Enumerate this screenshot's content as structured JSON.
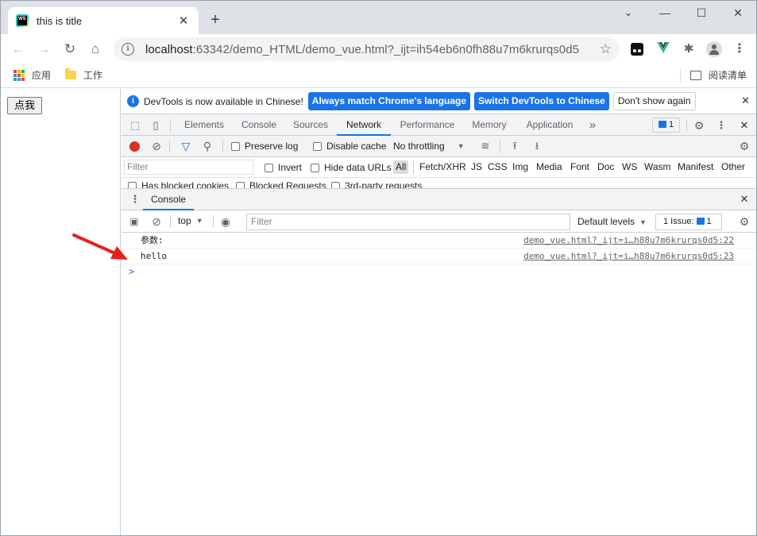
{
  "browser": {
    "tab_title": "this is title",
    "tab_close": "✕",
    "new_tab": "+",
    "window_controls": {
      "minimize": "⌄",
      "min": "—",
      "max": "☐",
      "close": "✕"
    },
    "url_host": "localhost",
    "url_rest": ":63342/demo_HTML/demo_vue.html?_ijt=ih54eb6n0fh88u7m6krurqs0d5",
    "bookmarks": [
      {
        "label": "应用",
        "icon": "apps-grid-icon"
      },
      {
        "label": "工作",
        "icon": "folder-icon"
      }
    ],
    "reading_list": "阅读清单"
  },
  "page": {
    "button_label": "点我"
  },
  "devtools": {
    "infobar": {
      "message": "DevTools is now available in Chinese!",
      "match_language": "Always match Chrome's language",
      "switch_chinese": "Switch DevTools to Chinese",
      "dont_show": "Don't show again"
    },
    "tabs": [
      "Elements",
      "Console",
      "Sources",
      "Network",
      "Performance",
      "Memory",
      "Application"
    ],
    "active_tab": "Network",
    "more_tabs": "»",
    "issues_count": "1",
    "network": {
      "preserve_log": "Preserve log",
      "disable_cache": "Disable cache",
      "throttling": "No throttling",
      "filter_placeholder": "Filter",
      "invert": "Invert",
      "hide_data_urls": "Hide data URLs",
      "types": [
        "All",
        "Fetch/XHR",
        "JS",
        "CSS",
        "Img",
        "Media",
        "Font",
        "Doc",
        "WS",
        "Wasm",
        "Manifest",
        "Other"
      ],
      "has_blocked_cookies": "Has blocked cookies",
      "blocked_requests": "Blocked Requests",
      "third_party": "3rd-party requests"
    },
    "drawer": {
      "tab": "Console",
      "context": "top",
      "filter_placeholder": "Filter",
      "levels": "Default levels",
      "issue_label": "1 Issue:",
      "issue_count": "1",
      "logs": [
        {
          "message": "参数:",
          "source": "demo_vue.html?_ijt=i…h88u7m6krurqs0d5:22"
        },
        {
          "message": "hello",
          "source": "demo_vue.html?_ijt=i…h88u7m6krurqs0d5:23"
        }
      ],
      "prompt": ">"
    }
  },
  "colors": {
    "accent": "#1a73e8",
    "record": "#d93025",
    "annotation_arrow": "#e8201a"
  }
}
